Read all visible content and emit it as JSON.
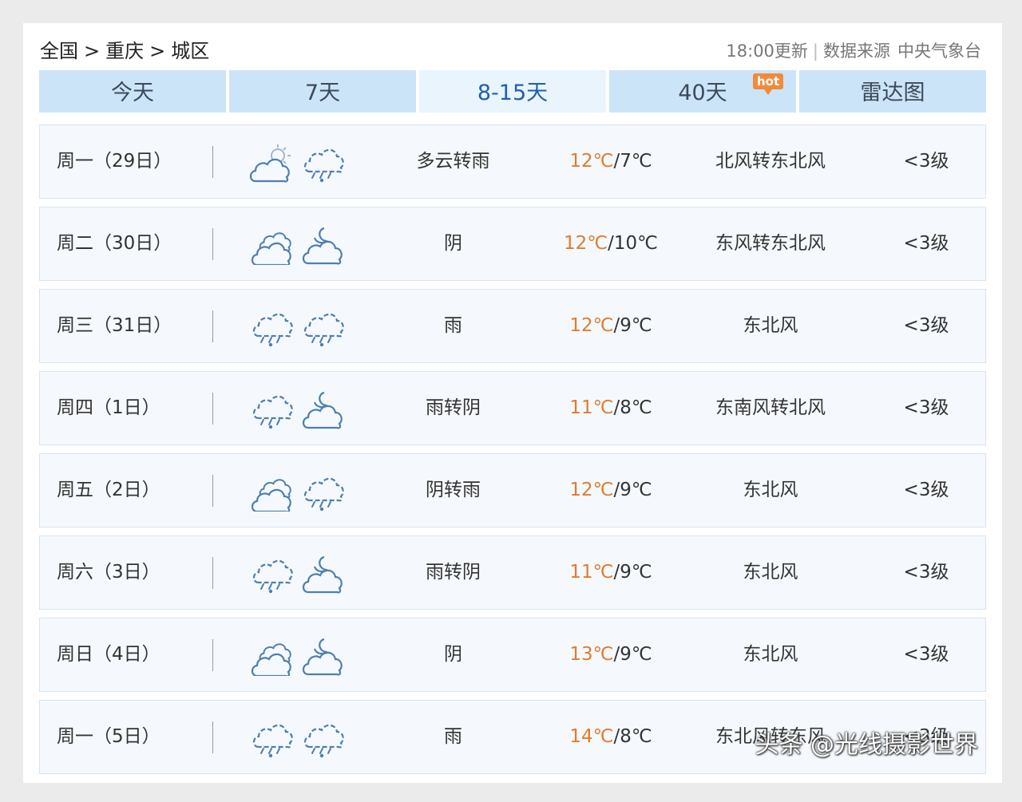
{
  "breadcrumb": {
    "items": [
      "全国",
      "重庆",
      "城区"
    ],
    "separator": ">"
  },
  "meta": {
    "update_time": "18:00更新",
    "source_label": "数据来源",
    "source_name": "中央气象台"
  },
  "tabs": [
    {
      "label": "今天",
      "active": false
    },
    {
      "label": "7天",
      "active": false
    },
    {
      "label": "8-15天",
      "active": true
    },
    {
      "label": "40天",
      "active": false,
      "badge": "hot"
    },
    {
      "label": "雷达图",
      "active": false
    }
  ],
  "colors": {
    "tab_bg": "#cce4f8",
    "tab_active_text": "#1f5fb0",
    "high_temp": "#e07b2e",
    "icon_stroke": "#4d7fb0",
    "badge": "#f08b3a"
  },
  "forecast": [
    {
      "day": "周一（29日）",
      "icons": [
        "partly-cloudy-icon",
        "rain-icon"
      ],
      "desc": "多云转雨",
      "high": "12℃",
      "low": "7℃",
      "wind": "北风转东北风",
      "level": "<3级"
    },
    {
      "day": "周二（30日）",
      "icons": [
        "overcast-icon",
        "cloudy-night-icon"
      ],
      "desc": "阴",
      "high": "12℃",
      "low": "10℃",
      "wind": "东风转东北风",
      "level": "<3级"
    },
    {
      "day": "周三（31日）",
      "icons": [
        "rain-icon",
        "rain-icon"
      ],
      "desc": "雨",
      "high": "12℃",
      "low": "9℃",
      "wind": "东北风",
      "level": "<3级"
    },
    {
      "day": "周四（1日）",
      "icons": [
        "rain-icon",
        "cloudy-night-icon"
      ],
      "desc": "雨转阴",
      "high": "11℃",
      "low": "8℃",
      "wind": "东南风转北风",
      "level": "<3级"
    },
    {
      "day": "周五（2日）",
      "icons": [
        "overcast-icon",
        "rain-icon"
      ],
      "desc": "阴转雨",
      "high": "12℃",
      "low": "9℃",
      "wind": "东北风",
      "level": "<3级"
    },
    {
      "day": "周六（3日）",
      "icons": [
        "rain-icon",
        "cloudy-night-icon"
      ],
      "desc": "雨转阴",
      "high": "11℃",
      "low": "9℃",
      "wind": "东北风",
      "level": "<3级"
    },
    {
      "day": "周日（4日）",
      "icons": [
        "overcast-icon",
        "cloudy-night-icon"
      ],
      "desc": "阴",
      "high": "13℃",
      "low": "9℃",
      "wind": "东北风",
      "level": "<3级"
    },
    {
      "day": "周一（5日）",
      "icons": [
        "rain-icon",
        "rain-icon"
      ],
      "desc": "雨",
      "high": "14℃",
      "low": "8℃",
      "wind": "东北风转东风",
      "level": "<3级"
    }
  ],
  "watermark": "头条 @光线摄影世界"
}
